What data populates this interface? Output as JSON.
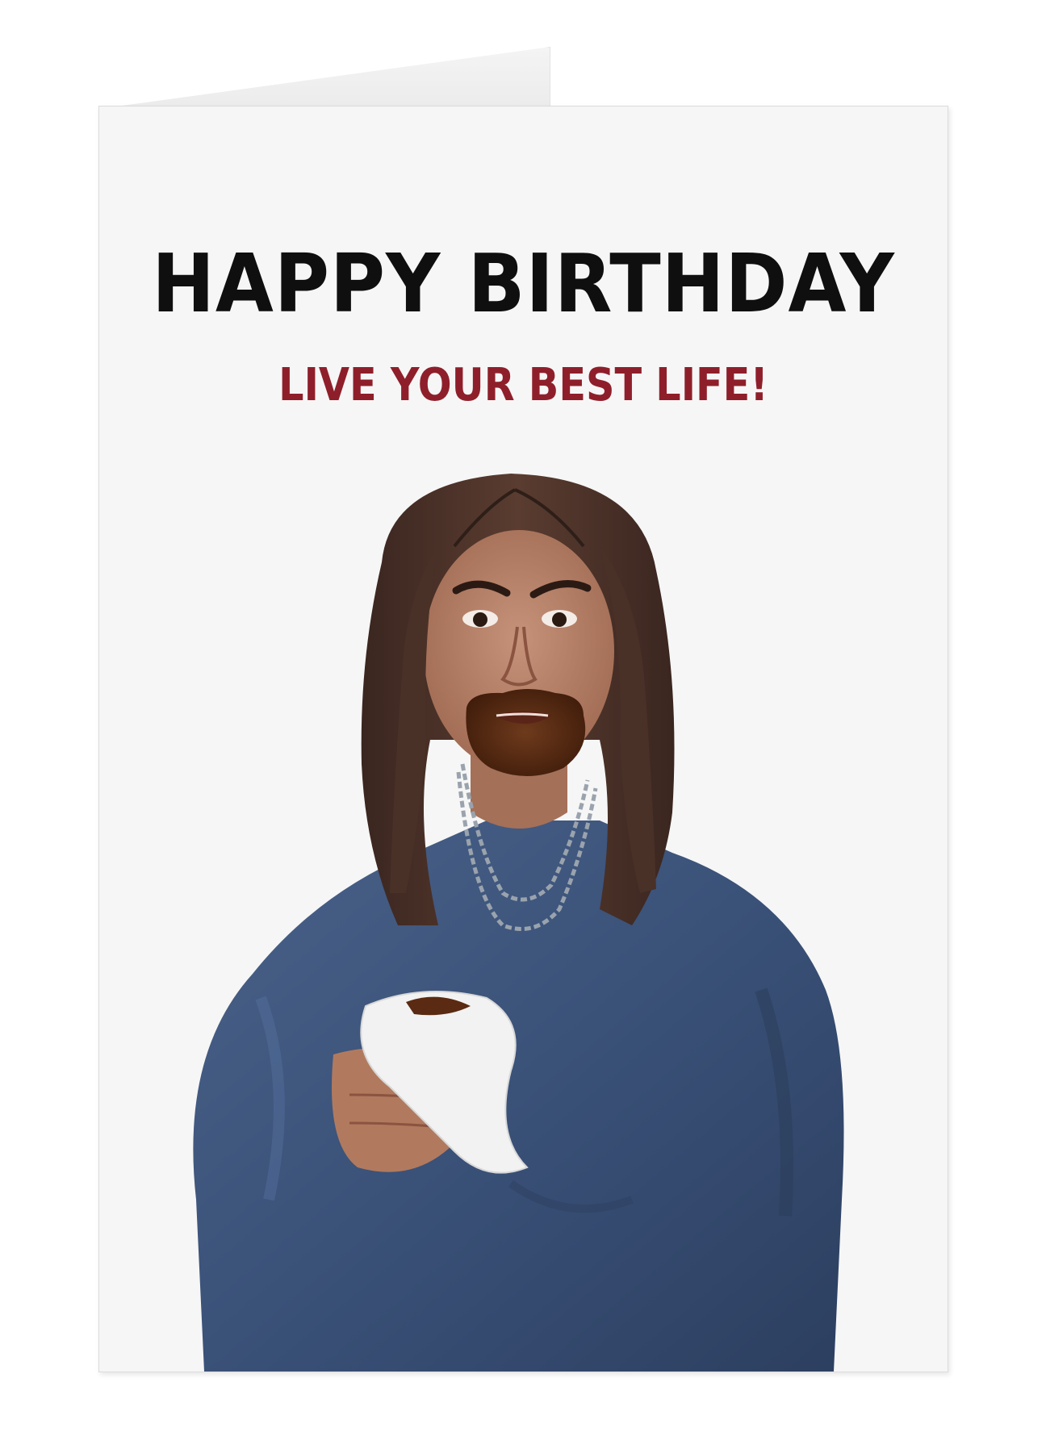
{
  "card": {
    "headline": "HAPPY BIRTHDAY",
    "subline": "LIVE YOUR BEST LIFE!"
  },
  "colors": {
    "headline": "#0f0f0f",
    "subline": "#8e1f2a",
    "card_background": "#f6f6f6",
    "sweater": "#3a5178",
    "hair": "#4a3128",
    "skin": "#b47d62",
    "chocolate": "#5a2a12",
    "tissue": "#f2f2f2"
  },
  "illustration": {
    "subject": "woman-with-chocolate-on-chin-holding-tissue"
  }
}
